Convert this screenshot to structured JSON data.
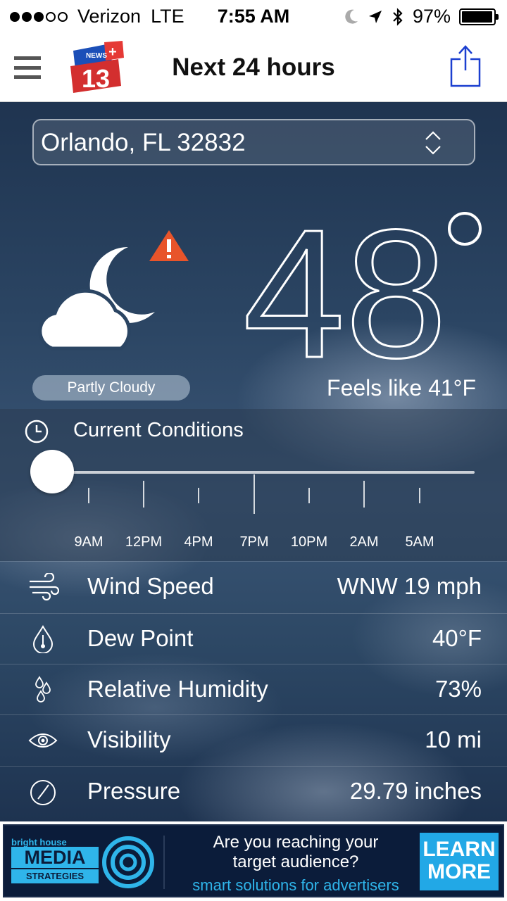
{
  "status_bar": {
    "carrier": "Verizon",
    "network": "LTE",
    "time": "7:55 AM",
    "battery": "97%",
    "battery_level": 0.97,
    "signal_bars": 3,
    "signal_total": 5,
    "icons": [
      "moon-icon",
      "location-arrow-icon",
      "bluetooth-icon",
      "battery-icon"
    ]
  },
  "navbar": {
    "title": "Next 24 hours",
    "logo_text": "NEWS 13",
    "logo_plus": "+",
    "icons": [
      "hamburger-menu-icon",
      "share-icon"
    ]
  },
  "location": {
    "value": "Orlando, FL 32832"
  },
  "current": {
    "temperature": "48",
    "condition": "Partly Cloudy",
    "feels_like": "Feels like  41°F",
    "alert": true
  },
  "timeline": {
    "label": "Current Conditions",
    "position": 0,
    "ticks": [
      "9AM",
      "12PM",
      "4PM",
      "7PM",
      "10PM",
      "2AM",
      "5AM"
    ]
  },
  "details": [
    {
      "icon": "wind-icon",
      "label": "Wind Speed",
      "value": "WNW 19 mph"
    },
    {
      "icon": "thermometer-drop-icon",
      "label": "Dew Point",
      "value": "40°F"
    },
    {
      "icon": "droplets-icon",
      "label": "Relative Humidity",
      "value": "73%"
    },
    {
      "icon": "eye-icon",
      "label": "Visibility",
      "value": "10 mi"
    },
    {
      "icon": "gauge-icon",
      "label": "Pressure",
      "value": "29.79 inches"
    }
  ],
  "ad": {
    "brand_top": "bright house",
    "brand_main": "MEDIA",
    "brand_bottom": "STRATEGIES",
    "line1": "Are you reaching your",
    "line2": "target audience?",
    "line3": "smart solutions for advertisers",
    "button": "LEARN MORE"
  },
  "colors": {
    "accent": "#2fb5ea",
    "alert": "#e8542a",
    "logo_red": "#d32f2f",
    "logo_blue": "#1b4fb8"
  }
}
